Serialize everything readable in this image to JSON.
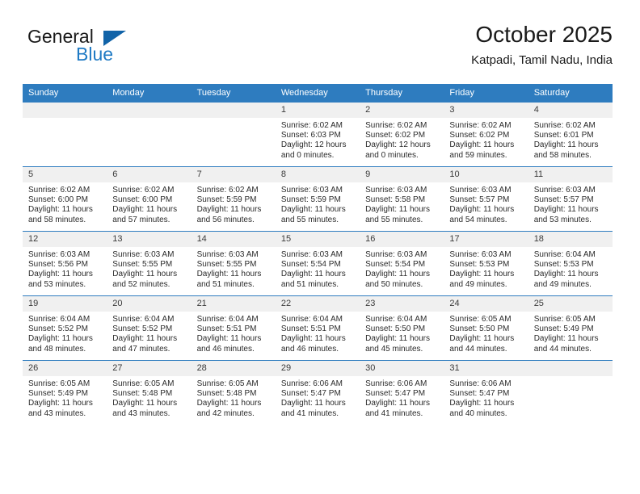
{
  "brand": {
    "word_one": "General",
    "word_two": "Blue",
    "triangle_icon": "brand-triangle-icon",
    "accent_color": "#1163a8",
    "blue_text_color": "#1f7ac4"
  },
  "header": {
    "title": "October 2025",
    "subtitle": "Katpadi, Tamil Nadu, India"
  },
  "theme": {
    "header_blue": "#2e7cbf",
    "daynum_grey": "#f0f0f0",
    "text": "#2b2b2b"
  },
  "weekdays": [
    "Sunday",
    "Monday",
    "Tuesday",
    "Wednesday",
    "Thursday",
    "Friday",
    "Saturday"
  ],
  "labels": {
    "sunrise_prefix": "Sunrise: ",
    "sunset_prefix": "Sunset: ",
    "daylight_prefix": "Daylight: "
  },
  "weeks": [
    [
      {
        "day": "",
        "empty": true
      },
      {
        "day": "",
        "empty": true
      },
      {
        "day": "",
        "empty": true
      },
      {
        "day": "1",
        "sunrise": "Sunrise: 6:02 AM",
        "sunset": "Sunset: 6:03 PM",
        "daylight_1": "Daylight: 12 hours",
        "daylight_2": "and 0 minutes."
      },
      {
        "day": "2",
        "sunrise": "Sunrise: 6:02 AM",
        "sunset": "Sunset: 6:02 PM",
        "daylight_1": "Daylight: 12 hours",
        "daylight_2": "and 0 minutes."
      },
      {
        "day": "3",
        "sunrise": "Sunrise: 6:02 AM",
        "sunset": "Sunset: 6:02 PM",
        "daylight_1": "Daylight: 11 hours",
        "daylight_2": "and 59 minutes."
      },
      {
        "day": "4",
        "sunrise": "Sunrise: 6:02 AM",
        "sunset": "Sunset: 6:01 PM",
        "daylight_1": "Daylight: 11 hours",
        "daylight_2": "and 58 minutes."
      }
    ],
    [
      {
        "day": "5",
        "sunrise": "Sunrise: 6:02 AM",
        "sunset": "Sunset: 6:00 PM",
        "daylight_1": "Daylight: 11 hours",
        "daylight_2": "and 58 minutes."
      },
      {
        "day": "6",
        "sunrise": "Sunrise: 6:02 AM",
        "sunset": "Sunset: 6:00 PM",
        "daylight_1": "Daylight: 11 hours",
        "daylight_2": "and 57 minutes."
      },
      {
        "day": "7",
        "sunrise": "Sunrise: 6:02 AM",
        "sunset": "Sunset: 5:59 PM",
        "daylight_1": "Daylight: 11 hours",
        "daylight_2": "and 56 minutes."
      },
      {
        "day": "8",
        "sunrise": "Sunrise: 6:03 AM",
        "sunset": "Sunset: 5:59 PM",
        "daylight_1": "Daylight: 11 hours",
        "daylight_2": "and 55 minutes."
      },
      {
        "day": "9",
        "sunrise": "Sunrise: 6:03 AM",
        "sunset": "Sunset: 5:58 PM",
        "daylight_1": "Daylight: 11 hours",
        "daylight_2": "and 55 minutes."
      },
      {
        "day": "10",
        "sunrise": "Sunrise: 6:03 AM",
        "sunset": "Sunset: 5:57 PM",
        "daylight_1": "Daylight: 11 hours",
        "daylight_2": "and 54 minutes."
      },
      {
        "day": "11",
        "sunrise": "Sunrise: 6:03 AM",
        "sunset": "Sunset: 5:57 PM",
        "daylight_1": "Daylight: 11 hours",
        "daylight_2": "and 53 minutes."
      }
    ],
    [
      {
        "day": "12",
        "sunrise": "Sunrise: 6:03 AM",
        "sunset": "Sunset: 5:56 PM",
        "daylight_1": "Daylight: 11 hours",
        "daylight_2": "and 53 minutes."
      },
      {
        "day": "13",
        "sunrise": "Sunrise: 6:03 AM",
        "sunset": "Sunset: 5:55 PM",
        "daylight_1": "Daylight: 11 hours",
        "daylight_2": "and 52 minutes."
      },
      {
        "day": "14",
        "sunrise": "Sunrise: 6:03 AM",
        "sunset": "Sunset: 5:55 PM",
        "daylight_1": "Daylight: 11 hours",
        "daylight_2": "and 51 minutes."
      },
      {
        "day": "15",
        "sunrise": "Sunrise: 6:03 AM",
        "sunset": "Sunset: 5:54 PM",
        "daylight_1": "Daylight: 11 hours",
        "daylight_2": "and 51 minutes."
      },
      {
        "day": "16",
        "sunrise": "Sunrise: 6:03 AM",
        "sunset": "Sunset: 5:54 PM",
        "daylight_1": "Daylight: 11 hours",
        "daylight_2": "and 50 minutes."
      },
      {
        "day": "17",
        "sunrise": "Sunrise: 6:03 AM",
        "sunset": "Sunset: 5:53 PM",
        "daylight_1": "Daylight: 11 hours",
        "daylight_2": "and 49 minutes."
      },
      {
        "day": "18",
        "sunrise": "Sunrise: 6:04 AM",
        "sunset": "Sunset: 5:53 PM",
        "daylight_1": "Daylight: 11 hours",
        "daylight_2": "and 49 minutes."
      }
    ],
    [
      {
        "day": "19",
        "sunrise": "Sunrise: 6:04 AM",
        "sunset": "Sunset: 5:52 PM",
        "daylight_1": "Daylight: 11 hours",
        "daylight_2": "and 48 minutes."
      },
      {
        "day": "20",
        "sunrise": "Sunrise: 6:04 AM",
        "sunset": "Sunset: 5:52 PM",
        "daylight_1": "Daylight: 11 hours",
        "daylight_2": "and 47 minutes."
      },
      {
        "day": "21",
        "sunrise": "Sunrise: 6:04 AM",
        "sunset": "Sunset: 5:51 PM",
        "daylight_1": "Daylight: 11 hours",
        "daylight_2": "and 46 minutes."
      },
      {
        "day": "22",
        "sunrise": "Sunrise: 6:04 AM",
        "sunset": "Sunset: 5:51 PM",
        "daylight_1": "Daylight: 11 hours",
        "daylight_2": "and 46 minutes."
      },
      {
        "day": "23",
        "sunrise": "Sunrise: 6:04 AM",
        "sunset": "Sunset: 5:50 PM",
        "daylight_1": "Daylight: 11 hours",
        "daylight_2": "and 45 minutes."
      },
      {
        "day": "24",
        "sunrise": "Sunrise: 6:05 AM",
        "sunset": "Sunset: 5:50 PM",
        "daylight_1": "Daylight: 11 hours",
        "daylight_2": "and 44 minutes."
      },
      {
        "day": "25",
        "sunrise": "Sunrise: 6:05 AM",
        "sunset": "Sunset: 5:49 PM",
        "daylight_1": "Daylight: 11 hours",
        "daylight_2": "and 44 minutes."
      }
    ],
    [
      {
        "day": "26",
        "sunrise": "Sunrise: 6:05 AM",
        "sunset": "Sunset: 5:49 PM",
        "daylight_1": "Daylight: 11 hours",
        "daylight_2": "and 43 minutes."
      },
      {
        "day": "27",
        "sunrise": "Sunrise: 6:05 AM",
        "sunset": "Sunset: 5:48 PM",
        "daylight_1": "Daylight: 11 hours",
        "daylight_2": "and 43 minutes."
      },
      {
        "day": "28",
        "sunrise": "Sunrise: 6:05 AM",
        "sunset": "Sunset: 5:48 PM",
        "daylight_1": "Daylight: 11 hours",
        "daylight_2": "and 42 minutes."
      },
      {
        "day": "29",
        "sunrise": "Sunrise: 6:06 AM",
        "sunset": "Sunset: 5:47 PM",
        "daylight_1": "Daylight: 11 hours",
        "daylight_2": "and 41 minutes."
      },
      {
        "day": "30",
        "sunrise": "Sunrise: 6:06 AM",
        "sunset": "Sunset: 5:47 PM",
        "daylight_1": "Daylight: 11 hours",
        "daylight_2": "and 41 minutes."
      },
      {
        "day": "31",
        "sunrise": "Sunrise: 6:06 AM",
        "sunset": "Sunset: 5:47 PM",
        "daylight_1": "Daylight: 11 hours",
        "daylight_2": "and 40 minutes."
      },
      {
        "day": "",
        "empty": true
      }
    ]
  ]
}
